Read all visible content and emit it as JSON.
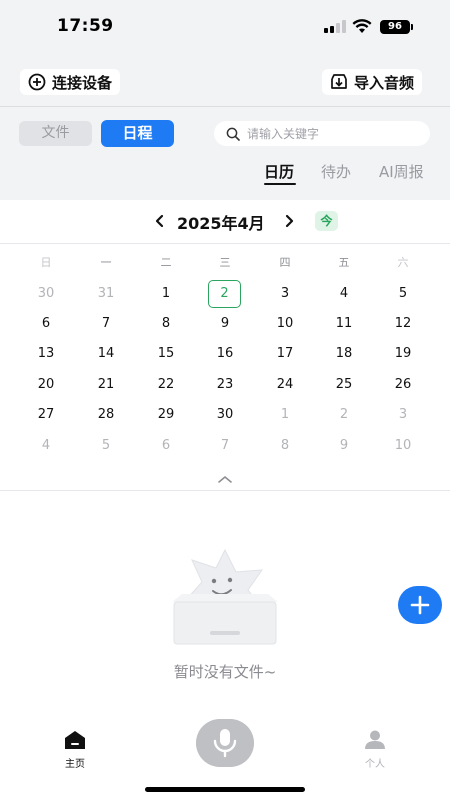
{
  "status_bar": {
    "time": "17:59",
    "battery": "96"
  },
  "header": {
    "connect_label": "连接设备",
    "connect_icon": "plus-circle-icon",
    "import_label": "导入音频",
    "import_icon": "import-icon"
  },
  "segments": {
    "file_label": "文件",
    "schedule_label": "日程",
    "active": "日程"
  },
  "search": {
    "placeholder": "请输入关键字",
    "value": ""
  },
  "view_tabs": [
    {
      "label": "日历",
      "active": true
    },
    {
      "label": "待办",
      "active": false
    },
    {
      "label": "AI周报",
      "active": false
    }
  ],
  "calendar": {
    "month_title": "2025年4月",
    "today_label": "今",
    "weekdays": [
      "日",
      "一",
      "二",
      "三",
      "四",
      "五",
      "六"
    ],
    "weeks": [
      [
        "30",
        "31",
        "1",
        "2",
        "3",
        "4",
        "5"
      ],
      [
        "6",
        "7",
        "8",
        "9",
        "10",
        "11",
        "12"
      ],
      [
        "13",
        "14",
        "15",
        "16",
        "17",
        "18",
        "19"
      ],
      [
        "20",
        "21",
        "22",
        "23",
        "24",
        "25",
        "26"
      ],
      [
        "27",
        "28",
        "29",
        "30",
        "1",
        "2",
        "3"
      ],
      [
        "4",
        "5",
        "6",
        "7",
        "8",
        "9",
        "10"
      ]
    ],
    "selected_day": "2",
    "colors": {
      "today": "#2ba45f",
      "accent": "#1e7bf4"
    }
  },
  "empty_state": {
    "text": "暂时没有文件~"
  },
  "bottom_nav": {
    "home_label": "主页",
    "me_label": "个人",
    "mic_icon": "microphone-icon"
  }
}
